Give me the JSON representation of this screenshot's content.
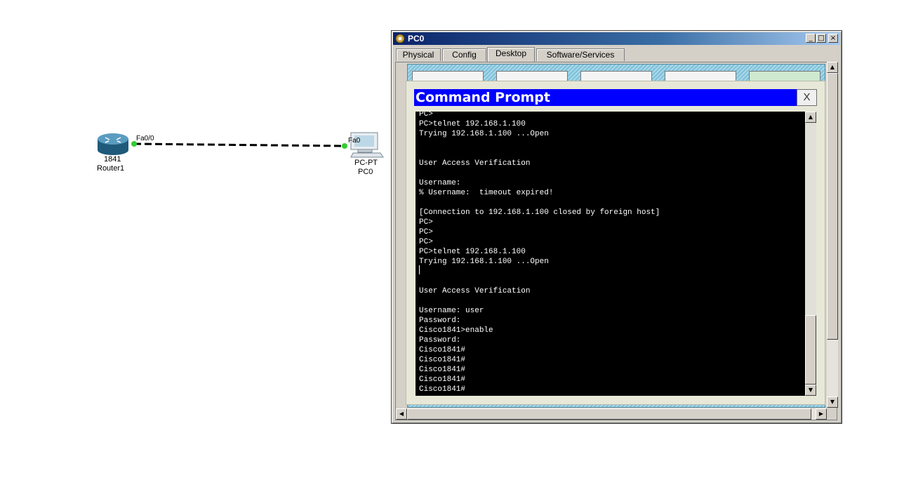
{
  "topology": {
    "router": {
      "model": "1841",
      "name": "Router1",
      "port": "Fa0/0"
    },
    "pc": {
      "model": "PC-PT",
      "name": "PC0",
      "port": "Fa0"
    }
  },
  "window": {
    "title": "PC0",
    "tabs": [
      {
        "label": "Physical",
        "active": false
      },
      {
        "label": "Config",
        "active": false
      },
      {
        "label": "Desktop",
        "active": true
      },
      {
        "label": "Software/Services",
        "active": false
      }
    ],
    "controls": {
      "minimize": "_",
      "maximize": "□",
      "close": "×"
    }
  },
  "command_prompt": {
    "title": "Command Prompt",
    "close_label": "X",
    "lines": [
      "PC>",
      "PC>telnet 192.168.1.100",
      "Trying 192.168.1.100 ...Open",
      "",
      "",
      "User Access Verification",
      "",
      "Username:",
      "% Username:  timeout expired!",
      "",
      "[Connection to 192.168.1.100 closed by foreign host]",
      "PC>",
      "PC>",
      "PC>",
      "PC>telnet 192.168.1.100",
      "Trying 192.168.1.100 ...Open",
      "",
      "",
      "User Access Verification",
      "",
      "Username: user",
      "Password:",
      "Cisco1841>enable",
      "Password:",
      "Cisco1841#",
      "Cisco1841#",
      "Cisco1841#",
      "Cisco1841#",
      "Cisco1841#"
    ]
  },
  "colors": {
    "titlebar_start": "#0a246a",
    "cmd_title": "#0000ff",
    "link_up": "#33cc33",
    "terminal_bg": "#000000",
    "terminal_fg": "#ffffff"
  }
}
